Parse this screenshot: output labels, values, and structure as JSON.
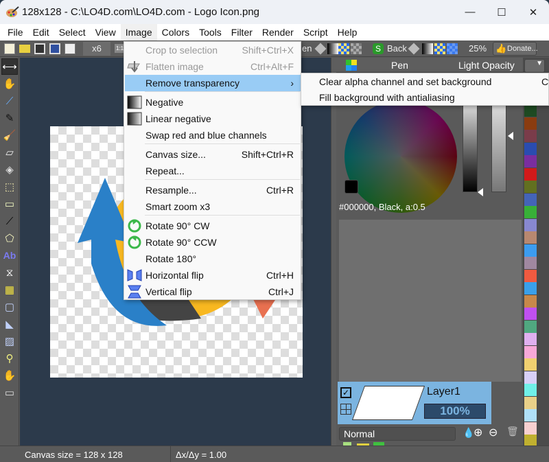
{
  "window": {
    "title": "128x128 - C:\\LO4D.com\\LO4D.com - Logo Icon.png",
    "minimize_glyph": "—",
    "maximize_glyph": "☐",
    "close_glyph": "✕"
  },
  "menubar": [
    "File",
    "Edit",
    "Select",
    "View",
    "Image",
    "Colors",
    "Tools",
    "Filter",
    "Render",
    "Script",
    "Help"
  ],
  "toolbar": {
    "zoom_factor": "x6",
    "actual_size": "1:1",
    "pen_partial": "en",
    "back_label": "Back",
    "zoom_percent": "25%",
    "donate_label": "Donate..."
  },
  "image_menu": [
    {
      "label": "Crop to selection",
      "shortcut": "Shift+Ctrl+X",
      "disabled": true,
      "icon": ""
    },
    {
      "label": "Flatten image",
      "shortcut": "Ctrl+Alt+F",
      "disabled": true,
      "icon": "flatten-icon"
    },
    {
      "label": "Remove transparency",
      "shortcut": "›",
      "highlighted": true,
      "icon": ""
    },
    {
      "label": "Negative",
      "shortcut": "",
      "icon": "negative-icon"
    },
    {
      "label": "Linear negative",
      "shortcut": "",
      "icon": "linear-negative-icon"
    },
    {
      "label": "Swap red and blue channels",
      "shortcut": "",
      "icon": ""
    },
    {
      "label": "Canvas size...",
      "shortcut": "Shift+Ctrl+R",
      "icon": ""
    },
    {
      "label": "Repeat...",
      "shortcut": "",
      "icon": ""
    },
    {
      "label": "Resample...",
      "shortcut": "Ctrl+R",
      "icon": ""
    },
    {
      "label": "Smart zoom x3",
      "shortcut": "",
      "icon": ""
    },
    {
      "label": "Rotate 90° CW",
      "shortcut": "",
      "icon": "rotate-cw-icon"
    },
    {
      "label": "Rotate 90° CCW",
      "shortcut": "",
      "icon": "rotate-ccw-icon"
    },
    {
      "label": "Rotate 180°",
      "shortcut": "",
      "icon": ""
    },
    {
      "label": "Horizontal flip",
      "shortcut": "Ctrl+H",
      "icon": "horizontal-flip-icon"
    },
    {
      "label": "Vertical flip",
      "shortcut": "Ctrl+J",
      "icon": "vertical-flip-icon"
    }
  ],
  "submenu": {
    "items": [
      "Clear alpha channel and set background",
      "Fill background with antialiasing"
    ],
    "partial_shortcut": "Ct"
  },
  "pen_panel": {
    "pen_label": "Pen",
    "opacity_label": "Light Opacity",
    "color_info": "#000000, Black, a:0.5"
  },
  "layers": {
    "name": "Layer1",
    "opacity": "100%",
    "blend_mode": "Normal"
  },
  "palette_colors": [
    "#1e4a22",
    "#8a3c10",
    "#7a3c4a",
    "#2a4cb0",
    "#7a2ea0",
    "#d21a1a",
    "#627020",
    "#4464b8",
    "#38b038",
    "#8888d0",
    "#b88870",
    "#3c9cf0",
    "#a088a0",
    "#f05a40",
    "#3aa0ea",
    "#c8884a",
    "#c050f0",
    "#50a880",
    "#e0b0f0",
    "#f8a8d8",
    "#f0d070",
    "#d8d0f8",
    "#70f0e8",
    "#e8d088",
    "#b0e0f8",
    "#f8d0d0",
    "#c0b030",
    "#80c0c0"
  ],
  "statusbar": {
    "canvas_size": "Canvas size = 128 x 128",
    "ratio": "Δx/Δy = 1.00"
  }
}
